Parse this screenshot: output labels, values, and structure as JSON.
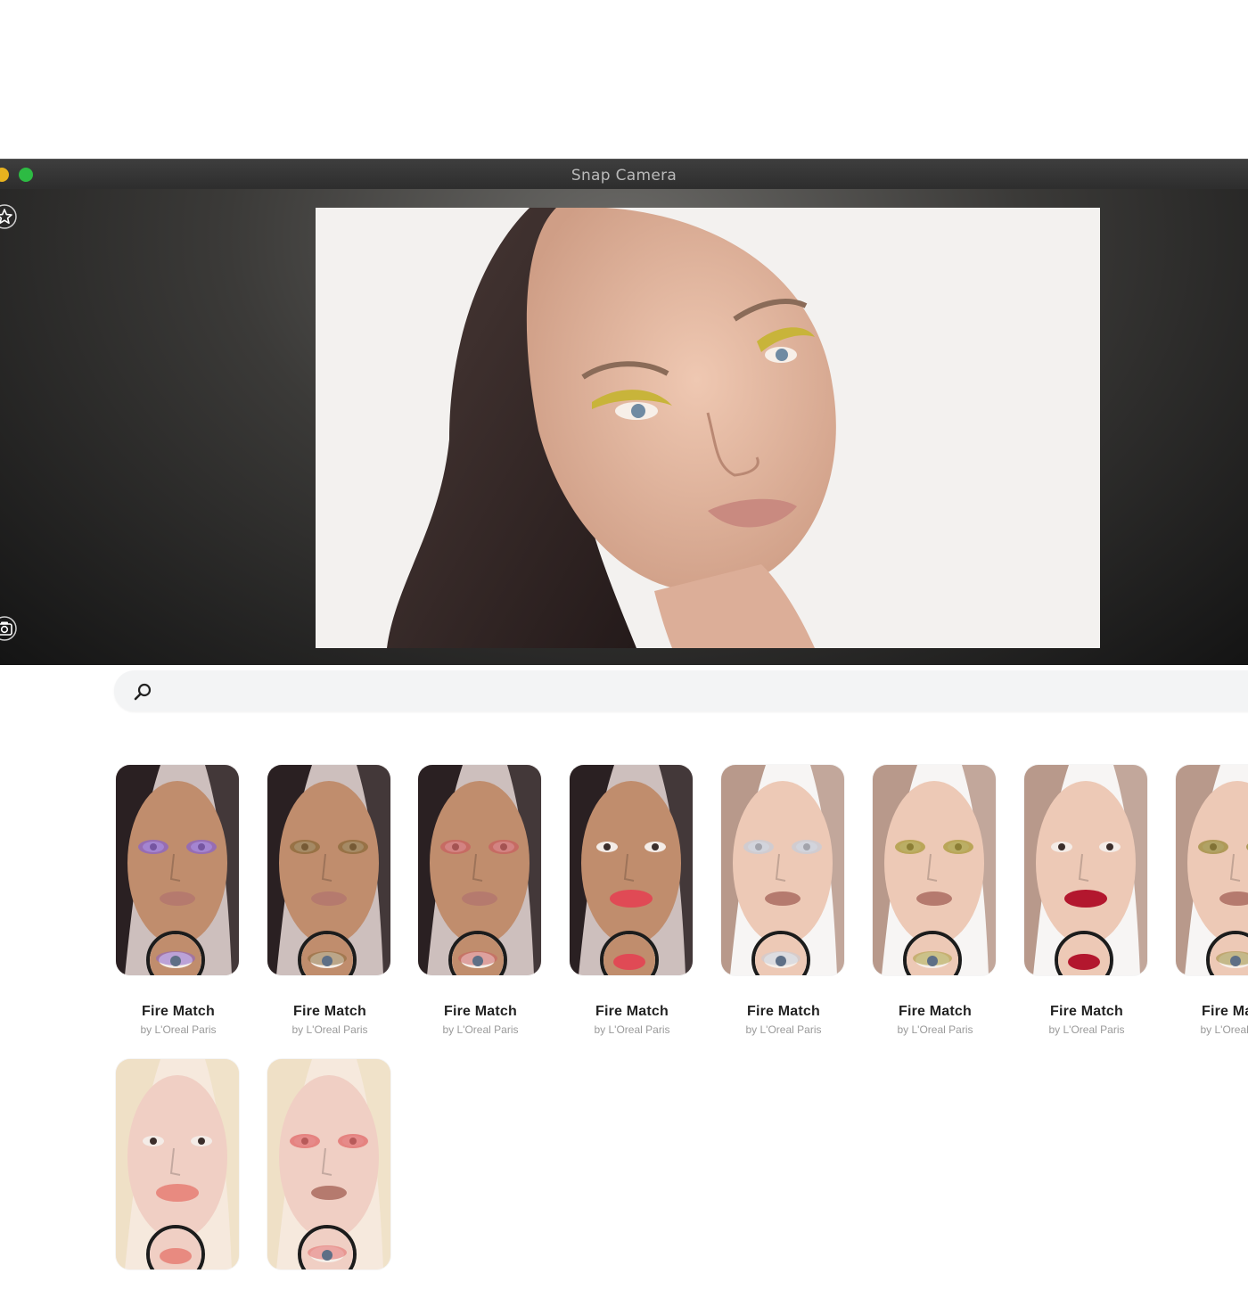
{
  "window": {
    "title": "Snap Camera"
  },
  "search": {
    "placeholder": "",
    "value": ""
  },
  "lenses": [
    {
      "name": "Fire Match",
      "author": "by L'Oreal Paris",
      "skin": "#c08d6d",
      "hair": "#2a2022",
      "bg": "#cdbfbd",
      "accent": "#8a63c9",
      "region": "eyes"
    },
    {
      "name": "Fire Match",
      "author": "by L'Oreal Paris",
      "skin": "#c08d6d",
      "hair": "#2a2022",
      "bg": "#cdbfbd",
      "accent": "#8b6a3a",
      "region": "eyes"
    },
    {
      "name": "Fire Match",
      "author": "by L'Oreal Paris",
      "skin": "#c08d6d",
      "hair": "#2a2022",
      "bg": "#cdbfbd",
      "accent": "#c86060",
      "region": "eyes"
    },
    {
      "name": "Fire Match",
      "author": "by L'Oreal Paris",
      "skin": "#c08d6d",
      "hair": "#2a2022",
      "bg": "#cdbfbd",
      "accent": "#e04a55",
      "region": "lips"
    },
    {
      "name": "Fire Match",
      "author": "by L'Oreal Paris",
      "skin": "#edc9b6",
      "hair": "#b8998b",
      "bg": "#f7f5f4",
      "accent": "#c7ccd8",
      "region": "eyes"
    },
    {
      "name": "Fire Match",
      "author": "by L'Oreal Paris",
      "skin": "#edc9b6",
      "hair": "#b8998b",
      "bg": "#f7f5f4",
      "accent": "#a89a3a",
      "region": "eyes"
    },
    {
      "name": "Fire Match",
      "author": "by L'Oreal Paris",
      "skin": "#edc9b6",
      "hair": "#b8998b",
      "bg": "#f7f5f4",
      "accent": "#b3172e",
      "region": "lips"
    },
    {
      "name": "Fire Match",
      "author": "by L'Oreal Paris",
      "skin": "#edc9b6",
      "hair": "#b8998b",
      "bg": "#f7f5f4",
      "accent": "#9a8a3a",
      "region": "eyes"
    },
    {
      "name": "",
      "author": "",
      "skin": "#f0cfc4",
      "hair": "#efe0c6",
      "bg": "#f6e9dd",
      "accent": "#e88a80",
      "region": "lips"
    },
    {
      "name": "",
      "author": "",
      "skin": "#f0cfc4",
      "hair": "#efe0c6",
      "bg": "#f6e9dd",
      "accent": "#e26a6a",
      "region": "eyes"
    }
  ],
  "colors": {
    "titlebar": "#333333",
    "close_yellow": "#e8b21f",
    "zoom_green": "#2dbb43",
    "preview_bg": "#f3f1ef"
  },
  "icons": [
    "star-icon",
    "camera-icon",
    "search-icon"
  ]
}
